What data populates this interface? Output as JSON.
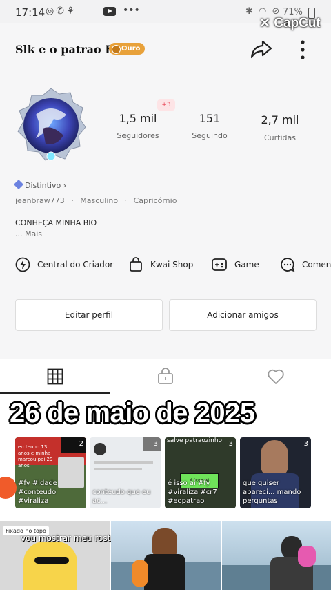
{
  "status_bar": {
    "time": "17:14",
    "battery": "71%"
  },
  "watermark": "CapCut",
  "profile": {
    "name": "Slk e o patrao FF",
    "rank_badge": "Ouro",
    "stats": [
      {
        "value": "1,5 mil",
        "label": "Seguidores"
      },
      {
        "value": "151",
        "label": "Seguindo"
      },
      {
        "value": "2,7 mil",
        "label": "Curtidas"
      }
    ],
    "new_followers_badge": "+3",
    "distintivo": "Distintivo",
    "username": "jeanbraw773",
    "gender": "Masculino",
    "sign": "Capricórnio",
    "separator": "·",
    "bio": "CONHEÇA MINHA BIO",
    "more": "...  Mais"
  },
  "shortcuts": [
    {
      "label": "Central do Criador",
      "icon": "bolt-icon"
    },
    {
      "label": "Kwai Shop",
      "icon": "shopping-bag-icon"
    },
    {
      "label": "Game",
      "icon": "gamepad-icon"
    },
    {
      "label": "Comentar",
      "icon": "chat-icon"
    }
  ],
  "buttons": {
    "edit": "Editar perfil",
    "add": "Adicionar amigos"
  },
  "date_overlay": "26 de maio de 2025",
  "thumbnails": [
    {
      "count": "2",
      "caption": "#fy #idade #conteudo #viraliza",
      "top_text": "eu tenho 13 anos e minha marcou pai 29 anos",
      "bg": "#4e6a3a"
    },
    {
      "count": "3",
      "caption": "conteudo que eu ac...",
      "bg": "#e9ecef"
    },
    {
      "count": "3",
      "caption": "é isso ai #fy #viraliza #cr7 #eopatrao",
      "top_text": "salve patraozinho",
      "inner": "é isso ai",
      "bg": "#2f3a2a"
    },
    {
      "count": "3",
      "caption": "que quiser apareci... mando perguntas",
      "bg": "#1f2430"
    }
  ],
  "pinned_label": "Fixado no topo",
  "pinned_caption": "vou mostrar meu rosto em..."
}
